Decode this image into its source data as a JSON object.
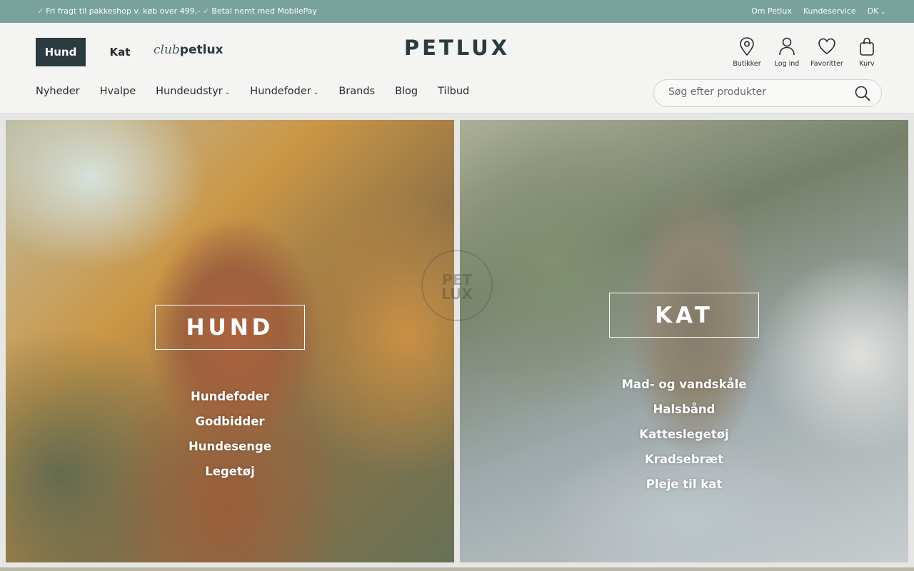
{
  "topbar": {
    "promo": [
      "Fri fragt til pakkeshop v. køb over 499,-",
      "Betal nemt med MobilePay"
    ],
    "check_glyph": "✓",
    "links": [
      "Om Petlux",
      "Kundeservice"
    ],
    "lang": "DK",
    "bg_color": "#78a29b"
  },
  "header": {
    "seg_hund": "Hund",
    "seg_kat": "Kat",
    "club_script": "club",
    "club_bold": "petlux",
    "logo": "PETLUX",
    "icons": [
      {
        "name": "location-pin-icon",
        "label": "Butikker"
      },
      {
        "name": "user-icon",
        "label": "Log ind"
      },
      {
        "name": "heart-icon",
        "label": "Favoritter"
      },
      {
        "name": "shopping-bag-icon",
        "label": "Kurv"
      }
    ],
    "nav": [
      "Nyheder",
      "Hvalpe",
      "Hundeudstyr",
      "Hundefoder",
      "Brands",
      "Blog",
      "Tilbud"
    ],
    "search_placeholder": "Søg efter produkter"
  },
  "panels": {
    "dog": {
      "title": "HUND",
      "links": [
        "Hundefoder",
        "Godbidder",
        "Hundesenge",
        "Legetøj"
      ]
    },
    "cat": {
      "title": "KAT",
      "links": [
        "Mad- og vandskåle",
        "Halsbånd",
        "Katteslegetøj",
        "Kradsebræt",
        "Pleje til kat"
      ]
    }
  },
  "watermark": {
    "line1": "PET",
    "line2": "LUX"
  },
  "colors": {
    "primary_dark": "#2c3b40",
    "topbar": "#78a29b"
  }
}
